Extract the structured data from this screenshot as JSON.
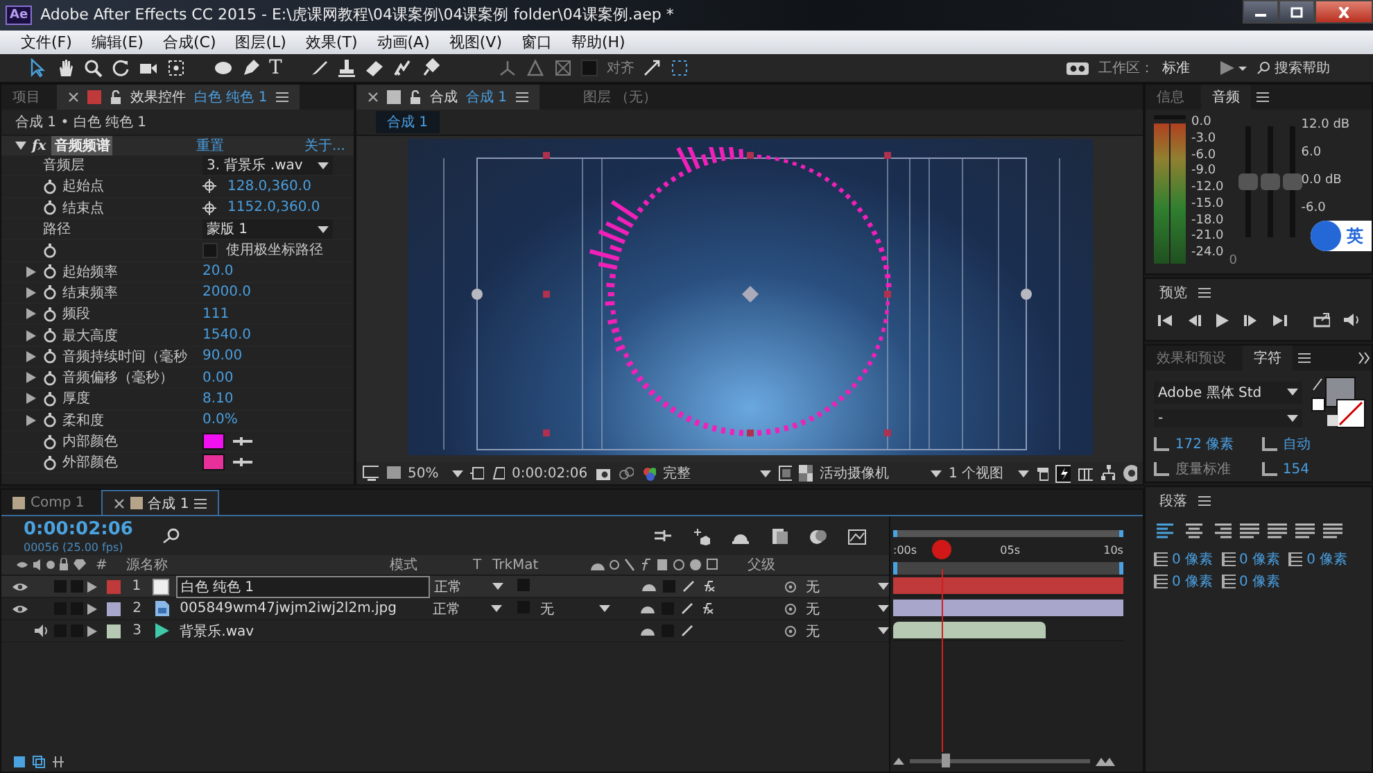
{
  "window": {
    "app_icon": "Ae",
    "title": "Adobe After Effects CC 2015 - E:\\虎课网教程\\04课案例\\04课案例 folder\\04课案例.aep *"
  },
  "menu": [
    "文件(F)",
    "编辑(E)",
    "合成(C)",
    "图层(L)",
    "效果(T)",
    "动画(A)",
    "视图(V)",
    "窗口",
    "帮助(H)"
  ],
  "toolbar": {
    "type_tool": "T",
    "snap_checked": false,
    "snap_label": "对齐",
    "workspace_label": "工作区：",
    "workspace": "标准",
    "search_placeholder": "搜索帮助"
  },
  "effect_panel": {
    "tabs": [
      {
        "label": "项目",
        "selected": false
      },
      {
        "label": "效果控件",
        "target": "白色 纯色 1",
        "selected": true
      }
    ],
    "breadcrumb": "合成 1 • 白色 纯色 1",
    "effect": {
      "fx": "fx",
      "name": "音频频谱",
      "reset": "重置",
      "about": "关于...",
      "expanded": true
    },
    "properties": [
      {
        "kind": "dropdown",
        "name": "音频层",
        "value": "3. 背景乐 .wav"
      },
      {
        "kind": "point",
        "name": "起始点",
        "value": "128.0,360.0"
      },
      {
        "kind": "point",
        "name": "结束点",
        "value": "1152.0,360.0"
      },
      {
        "kind": "dropdown",
        "name": "路径",
        "value": "蒙版 1"
      },
      {
        "kind": "checkbox",
        "label": "使用极坐标路径",
        "checked": false
      },
      {
        "kind": "number",
        "name": "起始频率",
        "value": "20.0",
        "expanded": false
      },
      {
        "kind": "number",
        "name": "结束频率",
        "value": "2000.0",
        "expanded": false
      },
      {
        "kind": "number",
        "name": "频段",
        "value": "111",
        "expanded": false
      },
      {
        "kind": "number",
        "name": "最大高度",
        "value": "1540.0",
        "expanded": false
      },
      {
        "kind": "number",
        "name": "音频持续时间（毫秒",
        "value": "90.00",
        "expanded": false
      },
      {
        "kind": "number",
        "name": "音频偏移（毫秒）",
        "value": "0.00",
        "expanded": false
      },
      {
        "kind": "number",
        "name": "厚度",
        "value": "8.10",
        "expanded": false
      },
      {
        "kind": "number",
        "name": "柔和度",
        "value": "0.0%",
        "expanded": false
      },
      {
        "kind": "color",
        "name": "内部颜色",
        "color": "#f010f0"
      },
      {
        "kind": "color",
        "name": "外部颜色",
        "color": "#e8309a"
      }
    ]
  },
  "comp_panel": {
    "tabs": [
      {
        "label": "合成",
        "target": "合成 1",
        "selected": true
      },
      {
        "label": "图层 （无）",
        "selected": false
      }
    ],
    "comp_chip": "合成 1",
    "zoom": "50%",
    "timecode": "0:00:02:06",
    "resolution": "完整",
    "camera": "活动摄像机",
    "views": "1 个视图"
  },
  "audio_panel": {
    "tabs": [
      {
        "label": "信息",
        "selected": false
      },
      {
        "label": "音频",
        "selected": true
      }
    ],
    "meters": [
      {
        "level": 0.97
      },
      {
        "level": 0.97
      }
    ],
    "scale": [
      "0.0",
      "-3.0",
      "-6.0",
      "-9.0",
      "-12.0",
      "-15.0",
      "-18.0",
      "-21.0",
      "-24.0"
    ],
    "fader_zero": "0",
    "faders": [
      {
        "level": 0.5
      },
      {
        "level": 0.5
      },
      {
        "level": 0.5
      }
    ],
    "db_scale": [
      "12.0 dB",
      "6.0",
      "0.0 dB",
      "-6.0"
    ],
    "ime_mode": "英"
  },
  "preview_panel": {
    "title": "预览"
  },
  "character_panel": {
    "tabs": [
      {
        "label": "效果和预设",
        "selected": false
      },
      {
        "label": "字符",
        "selected": true
      }
    ],
    "font": "Adobe 黑体 Std",
    "style": "-",
    "size": "172 像素",
    "leading": "自动",
    "kerning": "度量标准",
    "tracking": "154"
  },
  "paragraph_panel": {
    "title": "段落",
    "indents": [
      "0 像素",
      "0 像素",
      "0 像素",
      "0 像素",
      "0 像素"
    ]
  },
  "timeline": {
    "tabs": [
      {
        "label": "Comp 1",
        "selected": false
      },
      {
        "label": "合成 1",
        "selected": true
      }
    ],
    "timecode": "0:00:02:06",
    "frame_info": "00056 (25.00 fps)",
    "columns": {
      "number": "#",
      "name": "源名称",
      "mode": "模式",
      "t": "T",
      "trkmat": "TrkMat",
      "parent": "父级"
    },
    "ruler": [
      ":00s",
      "05s",
      "10s"
    ],
    "playhead": {
      "level": 0.21
    },
    "zoom_slider": {
      "level": 0.2
    },
    "layers": [
      {
        "kind": "solid",
        "number": "1",
        "name": "白色 纯色 1",
        "color": "#c0393b",
        "video": true,
        "audio": false,
        "selected": true,
        "mode": "正常",
        "parent": "无"
      },
      {
        "kind": "image",
        "number": "2",
        "name": "005849wm47jwjm2iwj2l2m.jpg",
        "color": "#a9a6cc",
        "video": true,
        "audio": false,
        "selected": false,
        "mode": "正常",
        "trkmat": "无",
        "parent": "无"
      },
      {
        "kind": "audio",
        "number": "3",
        "name": "背景乐.wav",
        "color": "#b5c9b3",
        "video": false,
        "audio": true,
        "selected": false,
        "parent": "无"
      }
    ]
  }
}
